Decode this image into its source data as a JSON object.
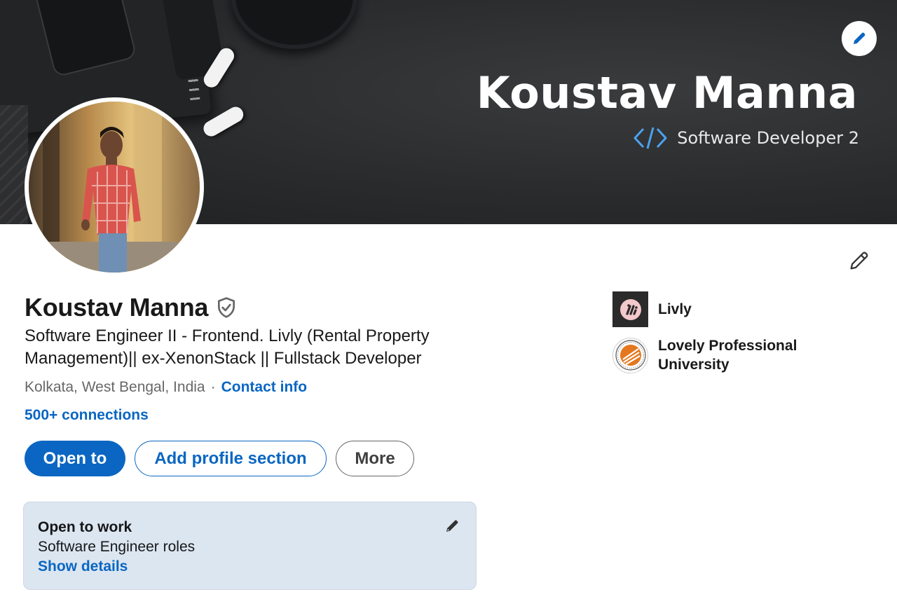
{
  "banner": {
    "title": "Koustav Manna",
    "subtitle": "Software Developer 2",
    "code_icon": "code-brackets-icon",
    "edit_icon": "pencil-icon"
  },
  "profile": {
    "name": "Koustav Manna",
    "verified_icon": "verified-shield-icon",
    "headline": "Software Engineer II - Frontend. Livly (Rental Property Management)|| ex-XenonStack || Fullstack Developer",
    "location": "Kolkata, West Bengal, India",
    "separator": "·",
    "contact_info": "Contact info",
    "connections": "500+ connections",
    "edit_icon": "pencil-icon"
  },
  "actions": {
    "open_to": "Open to",
    "add_profile_section": "Add profile section",
    "more": "More"
  },
  "open_to_work": {
    "title": "Open to work",
    "roles": "Software Engineer roles",
    "show_details": "Show details",
    "edit_icon": "pencil-icon"
  },
  "organizations": [
    {
      "name": "Livly",
      "logo": "livly-logo"
    },
    {
      "name": "Lovely Professional University",
      "logo": "lpu-seal-logo"
    }
  ],
  "colors": {
    "brand_blue": "#0a66c2",
    "card_bg": "#dce6f1",
    "banner_bg": "#2a2b2d"
  }
}
